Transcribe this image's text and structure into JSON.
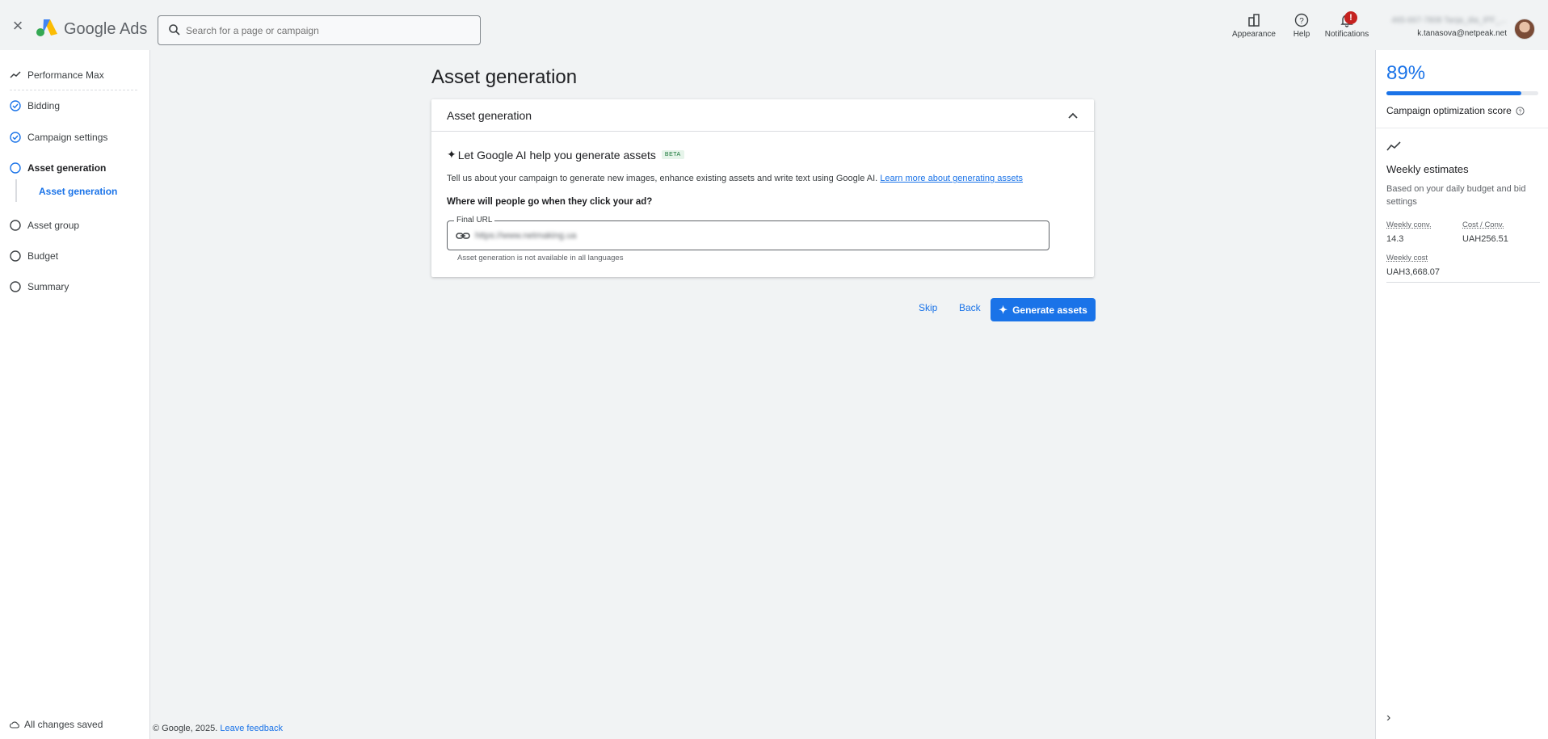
{
  "app": {
    "name": "Google Ads",
    "search_placeholder": "Search for a page or campaign"
  },
  "topbar": {
    "appearance_label": "Appearance",
    "help_label": "Help",
    "notifications_label": "Notifications",
    "notifications_badge": "!",
    "account_name": "465-667-7808 Tanja_dia_IPF_...",
    "account_email": "k.tanasova@netpeak.net"
  },
  "sidebar": {
    "items": [
      {
        "label": "Performance Max",
        "state": "trend"
      },
      {
        "label": "Bidding",
        "state": "done"
      },
      {
        "label": "Campaign settings",
        "state": "done"
      },
      {
        "label": "Asset generation",
        "state": "current"
      },
      {
        "label": "Asset group",
        "state": "todo"
      },
      {
        "label": "Budget",
        "state": "todo"
      },
      {
        "label": "Summary",
        "state": "todo"
      }
    ],
    "sub_item": "Asset generation",
    "saved_status": "All changes saved"
  },
  "footer": {
    "copyright": "© Google, 2025.",
    "feedback": "Leave feedback"
  },
  "main": {
    "page_title": "Asset generation",
    "card_title": "Asset generation",
    "ai_heading": "Let Google AI help you generate assets",
    "beta_badge": "BETA",
    "description": "Tell us about your campaign to generate new images, enhance existing assets and write text using Google AI.",
    "learn_more": "Learn more about generating assets",
    "question": "Where will people go when they click your ad?",
    "final_url_label": "Final URL",
    "final_url_value": "https://www.netmaking.ua",
    "hint": "Asset generation is not available in all languages",
    "skip_label": "Skip",
    "back_label": "Back",
    "generate_label": "Generate assets"
  },
  "right_panel": {
    "score": "89%",
    "score_fraction": 0.89,
    "score_label": "Campaign optimization score",
    "weekly_title": "Weekly estimates",
    "weekly_sub": "Based on your daily budget and bid settings",
    "weekly_conv_label": "Weekly conv.",
    "weekly_conv_value": "14.3",
    "cost_conv_label": "Cost / Conv.",
    "cost_conv_value": "UAH256.51",
    "weekly_cost_label": "Weekly cost",
    "weekly_cost_value": "UAH3,668.07"
  },
  "colors": {
    "accent": "#1a73e8",
    "badge_red": "#c5221f",
    "background": "#f1f3f4"
  }
}
